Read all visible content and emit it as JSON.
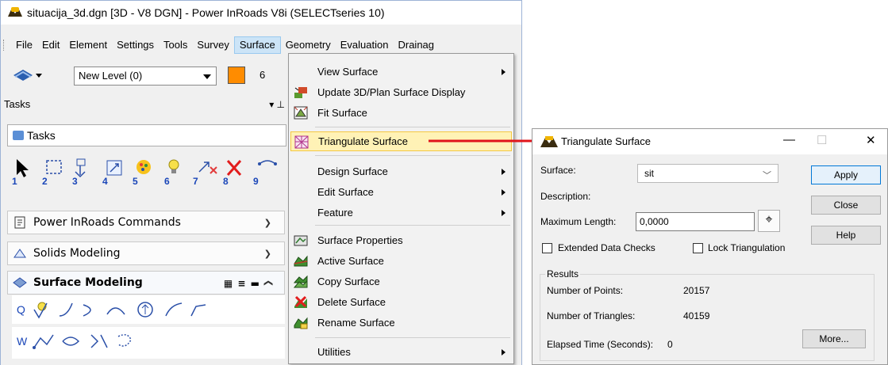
{
  "main_window": {
    "title": "situacija_3d.dgn [3D - V8 DGN] - Power InRoads V8i (SELECTseries 10)",
    "menu": [
      "File",
      "Edit",
      "Element",
      "Settings",
      "Tools",
      "Survey",
      "Surface",
      "Geometry",
      "Evaluation",
      "Drainag"
    ],
    "active_menu": "Surface",
    "toolbar": {
      "level_value": "New Level (0)",
      "color": "#ff8c00",
      "weight_value": "6"
    },
    "tasks_header": "Tasks",
    "tasks_combo": "Tasks",
    "task_numbers": [
      "1",
      "2",
      "3",
      "4",
      "5",
      "6",
      "7",
      "8",
      "9"
    ],
    "panels": [
      {
        "label": "Power InRoads Commands",
        "icon": "document-icon"
      },
      {
        "label": "Solids Modeling",
        "icon": "solid-icon"
      },
      {
        "label": "Surface Modeling",
        "icon": "surface-icon"
      }
    ],
    "row_labels": [
      "Q",
      "W"
    ]
  },
  "surface_menu": {
    "items": [
      {
        "label": "View Surface",
        "submenu": true,
        "icon": ""
      },
      {
        "label": "Update 3D/Plan Surface Display",
        "submenu": false,
        "icon": "update-display-icon"
      },
      {
        "label": "Fit Surface",
        "submenu": false,
        "icon": "fit-surface-icon"
      },
      {
        "label": "Triangulate Surface",
        "submenu": false,
        "icon": "triangulate-icon",
        "highlight": true
      },
      {
        "label": "Design Surface",
        "submenu": true,
        "icon": ""
      },
      {
        "label": "Edit Surface",
        "submenu": true,
        "icon": ""
      },
      {
        "label": "Feature",
        "submenu": true,
        "icon": ""
      },
      {
        "label": "Surface Properties",
        "submenu": false,
        "icon": "surface-properties-icon"
      },
      {
        "label": "Active Surface",
        "submenu": false,
        "icon": "active-surface-icon"
      },
      {
        "label": "Copy Surface",
        "submenu": false,
        "icon": "copy-surface-icon"
      },
      {
        "label": "Delete Surface",
        "submenu": false,
        "icon": "delete-surface-icon"
      },
      {
        "label": "Rename Surface",
        "submenu": false,
        "icon": "rename-surface-icon"
      },
      {
        "label": "Utilities",
        "submenu": true,
        "icon": ""
      }
    ]
  },
  "dialog": {
    "title": "Triangulate Surface",
    "surface_label": "Surface:",
    "surface_value": "sit",
    "description_label": "Description:",
    "max_length_label": "Maximum Length:",
    "max_length_value": "0,0000",
    "extended_checks_label": "Extended Data Checks",
    "lock_triangulation_label": "Lock Triangulation",
    "buttons": {
      "apply": "Apply",
      "close": "Close",
      "help": "Help",
      "more": "More..."
    },
    "results": {
      "title": "Results",
      "points_label": "Number of Points:",
      "points_value": "20157",
      "triangles_label": "Number of Triangles:",
      "triangles_value": "40159",
      "elapsed_label": "Elapsed Time (Seconds):",
      "elapsed_value": "0"
    }
  }
}
